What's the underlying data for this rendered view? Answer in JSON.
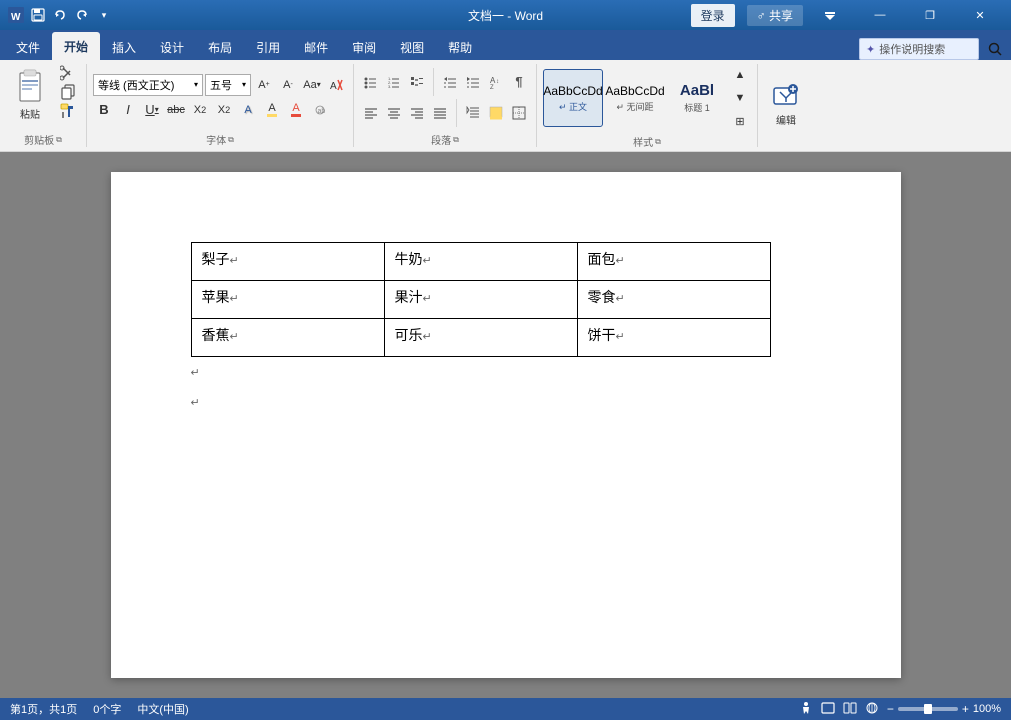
{
  "app": {
    "title": "文档一 - Word",
    "login_label": "登录",
    "share_label": "♂ 共享"
  },
  "titlebar": {
    "qat_buttons": [
      "save",
      "undo",
      "redo",
      "customize"
    ],
    "win_buttons": [
      "minimize",
      "restore",
      "close"
    ]
  },
  "ribbon": {
    "tabs": [
      "文件",
      "开始",
      "插入",
      "设计",
      "布局",
      "引用",
      "邮件",
      "审阅",
      "视图",
      "帮助"
    ],
    "active_tab": "开始",
    "search_placeholder": "✦ 操作说明搜索",
    "groups": {
      "clipboard": {
        "label": "剪贴板",
        "paste": "粘贴",
        "cut": "✂",
        "copy": "⿻",
        "format": "✓"
      },
      "font": {
        "label": "字体",
        "font_name": "等线 (西文正文)",
        "font_size": "五号",
        "grow": "A↑",
        "shrink": "A↓",
        "case": "Aa",
        "clear": "A",
        "highlight": "A",
        "bold": "B",
        "italic": "I",
        "underline": "U",
        "strikethrough": "abc",
        "subscript": "X₂",
        "superscript": "X²",
        "font_color": "A"
      },
      "paragraph": {
        "label": "段落",
        "bullets": "≡•",
        "numbering": "1.",
        "multilevel": "≡",
        "decrease_indent": "⇤",
        "increase_indent": "⇥",
        "sort": "↕A",
        "show_marks": "¶",
        "align_left": "≡",
        "align_center": "≡",
        "align_right": "≡",
        "justify": "≡",
        "line_spacing": "↕",
        "shading": "▒",
        "borders": "⊟"
      },
      "styles": {
        "label": "样式",
        "items": [
          {
            "id": "normal",
            "name": "正文",
            "preview": "AaBbCcDd"
          },
          {
            "id": "no_spacing",
            "name": "无间距",
            "preview": "AaBbCcDd"
          },
          {
            "id": "heading1",
            "name": "标题 1",
            "preview": "AaBl"
          }
        ]
      },
      "editing": {
        "label": "",
        "button": "编辑"
      }
    }
  },
  "document": {
    "table": {
      "rows": [
        [
          "梨子↵",
          "牛奶↵",
          "面包↵"
        ],
        [
          "苹果↵",
          "果汁↵",
          "零食↵"
        ],
        [
          "香蕉↵",
          "可乐↵",
          "饼干↵"
        ]
      ]
    }
  },
  "statusbar": {
    "page_info": "第1页，共1页",
    "word_count": "0个字",
    "lang": "中文(中国)",
    "zoom": "100%"
  }
}
